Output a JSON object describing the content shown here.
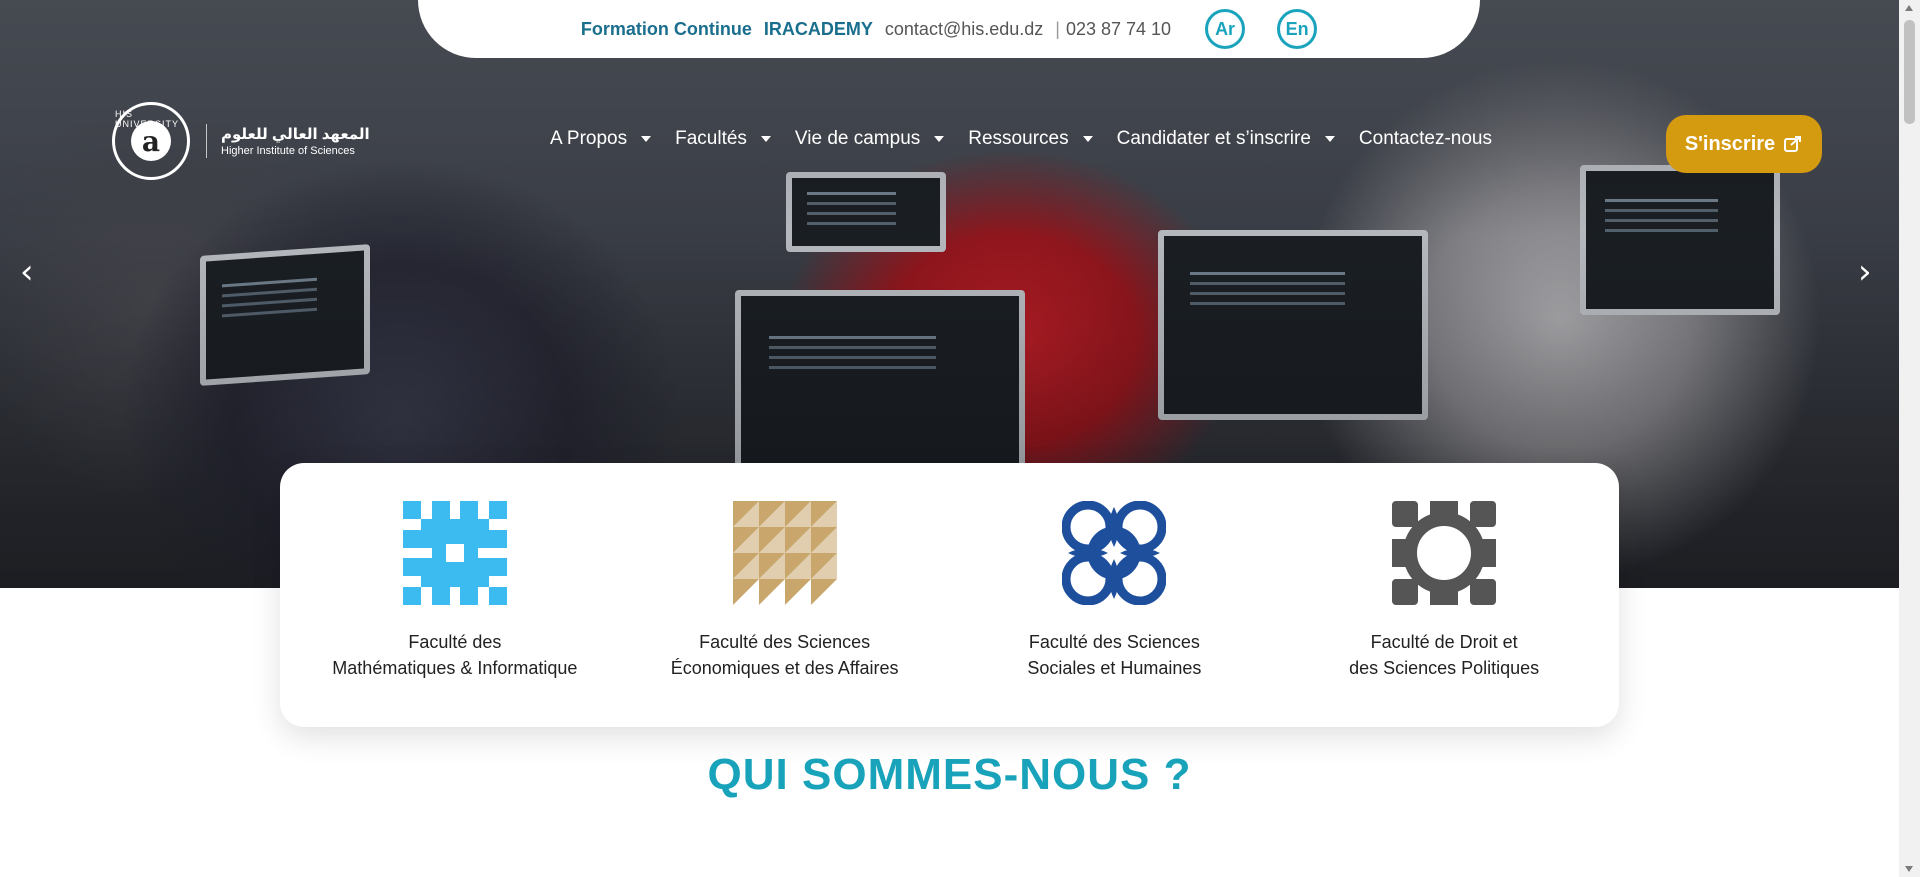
{
  "topbar": {
    "formation_label": "Formation Continue",
    "academy_label": "IRACADEMY",
    "email": "contact@his.edu.dz",
    "separator": "|",
    "phone": "023 87 74 10",
    "lang_ar": "Ar",
    "lang_en": "En"
  },
  "logo": {
    "ring_text": "HIS UNIVERSITY",
    "mark": "a",
    "arabic_name": "المعهد العالي للعلوم",
    "english_name": "Higher Institute of Sciences"
  },
  "nav": {
    "items": [
      {
        "label": "A Propos",
        "has_dropdown": true
      },
      {
        "label": "Facultés",
        "has_dropdown": true
      },
      {
        "label": "Vie de campus",
        "has_dropdown": true
      },
      {
        "label": "Ressources",
        "has_dropdown": true
      },
      {
        "label": "Candidater et s’inscrire",
        "has_dropdown": true
      },
      {
        "label": "Contactez-nous",
        "has_dropdown": false
      }
    ],
    "cta_label": "S'inscrire",
    "cta_icon": "external-share-icon"
  },
  "carousel": {
    "prev_icon": "chevron-left-icon",
    "next_icon": "chevron-right-icon",
    "prev_glyph": "‹",
    "next_glyph": "›"
  },
  "faculties": [
    {
      "line1": "Faculté des",
      "line2": "Mathématiques & Informatique",
      "icon": "pixel-cross-pattern-icon",
      "color": "#3bbbef"
    },
    {
      "line1": "Faculté des Sciences",
      "line2": "Économiques et des Affaires",
      "icon": "triangle-grid-pattern-icon",
      "color": "#c9a66b"
    },
    {
      "line1": "Faculté des Sciences",
      "line2": "Sociales et Humaines",
      "icon": "interlocking-circles-pattern-icon",
      "color": "#1d4f9c"
    },
    {
      "line1": "Faculté de Droit et",
      "line2": "des Sciences Politiques",
      "icon": "gear-ring-pattern-icon",
      "color": "#555555"
    }
  ],
  "section": {
    "title": "QUI SOMMES-NOUS ?"
  },
  "colors": {
    "accent": "#18a3bb",
    "cta": "#d49a10",
    "topbar_link": "#1a6e8e"
  }
}
